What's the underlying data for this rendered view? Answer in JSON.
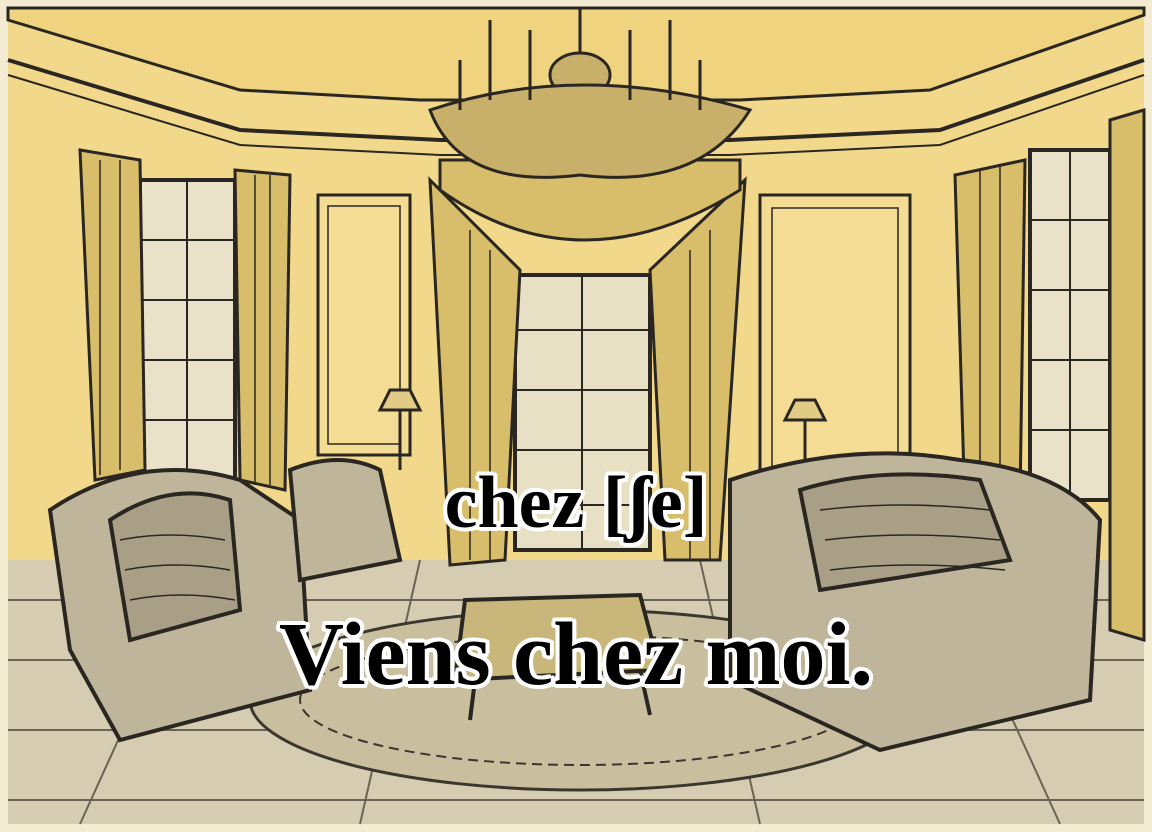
{
  "captions": {
    "word": "chez [ʃe]",
    "sentence": "Viens chez moi."
  },
  "palette": {
    "wall": "#f2d88a",
    "ink": "#2a2722",
    "floor": "#cfc6ad",
    "paper": "#f3ecd2"
  }
}
